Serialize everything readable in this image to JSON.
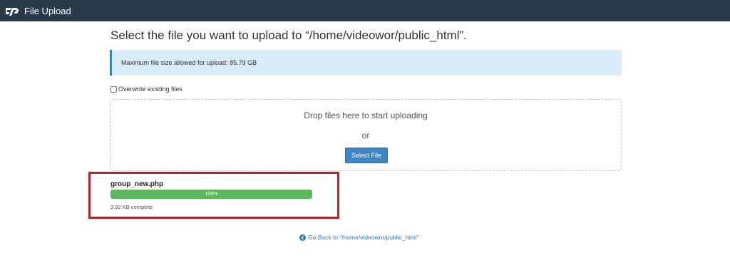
{
  "header": {
    "title": "File Upload",
    "logo_icon": "cpanel-logo-icon"
  },
  "main": {
    "heading": "Select the file you want to upload to “/home/videowor/public_html”.",
    "alert_text": "Maximum file size allowed for upload: 85.79 GB",
    "overwrite_label": "Overwrite existing files",
    "overwrite_checked": false,
    "dropzone": {
      "drop_text": "Drop files here to start uploading",
      "or_text": "or",
      "select_button": "Select File"
    },
    "upload": {
      "file_name": "group_new.php",
      "progress_label": "100%",
      "progress_fraction": 1.0,
      "status": "3.92 KB complete"
    },
    "back_link": "Go Back to “/home/videowor/public_html”"
  },
  "colors": {
    "topbar": "#293a4a",
    "accent": "#3d86c6",
    "progress": "#5cb85c",
    "highlight": "#c0202a",
    "alert_bg": "#d9ecf8"
  }
}
